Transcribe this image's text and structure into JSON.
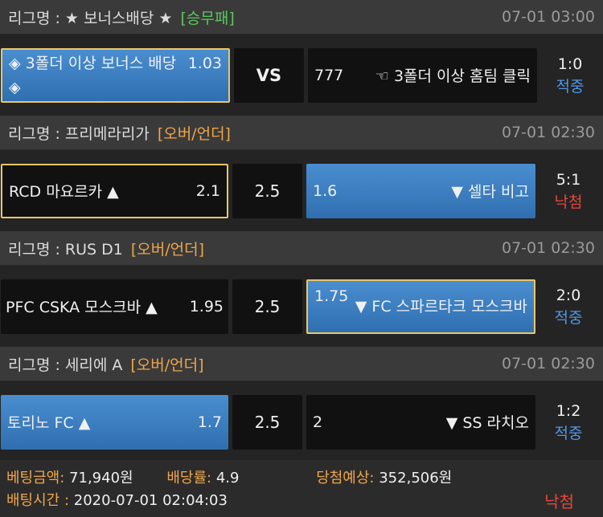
{
  "colors": {
    "orange": "#f0a64a",
    "green": "#5cc85c",
    "blue_hit": "#4f97e6",
    "red_miss": "#e8453c",
    "selected_border": "#e8c66a"
  },
  "matches": [
    {
      "league_label": "리그명 : ★ 보너스배당 ★",
      "market": "[승무패]",
      "market_color": "green",
      "datetime": "07-01 03:00",
      "home_name": "◈ 3폴더 이상 보너스 배당 ◈",
      "home_odds": "1.03",
      "middle": "VS",
      "away_odds": "777",
      "away_name": "☜ 3폴더 이상 홈팀 클릭",
      "score": "1:0",
      "result": "적중"
    },
    {
      "league_label": "리그명 : 프리메라리가",
      "market": "[오버/언더]",
      "market_color": "orange",
      "datetime": "07-01 02:30",
      "home_name": "RCD 마요르카 ▲",
      "home_odds": "2.1",
      "middle": "2.5",
      "away_odds": "1.6",
      "away_name": "▼ 셀타 비고",
      "score": "5:1",
      "result": "낙첨"
    },
    {
      "league_label": "리그명 : RUS D1",
      "market": "[오버/언더]",
      "market_color": "orange",
      "datetime": "07-01 02:30",
      "home_name": "PFC CSKA 모스크바 ▲",
      "home_odds": "1.95",
      "middle": "2.5",
      "away_odds": "1.75",
      "away_name": "▼ FC 스파르타크 모스크바",
      "score": "2:0",
      "result": "적중"
    },
    {
      "league_label": "리그명 : 세리에 A",
      "market": "[오버/언더]",
      "market_color": "orange",
      "datetime": "07-01 02:30",
      "home_name": "토리노 FC ▲",
      "home_odds": "1.7",
      "middle": "2.5",
      "away_odds": "2",
      "away_name": "▼ SS 라치오",
      "score": "1:2",
      "result": "적중"
    }
  ],
  "footer": {
    "bet_amount_label": "베팅금액:",
    "bet_amount": "71,940원",
    "odds_label": "배당률:",
    "odds": "4.9",
    "expected_label": "당첨예상:",
    "expected": "352,506원",
    "bet_time_label": "배팅시간 :",
    "bet_time": "2020-07-01 02:04:03",
    "status": "낙첨"
  }
}
